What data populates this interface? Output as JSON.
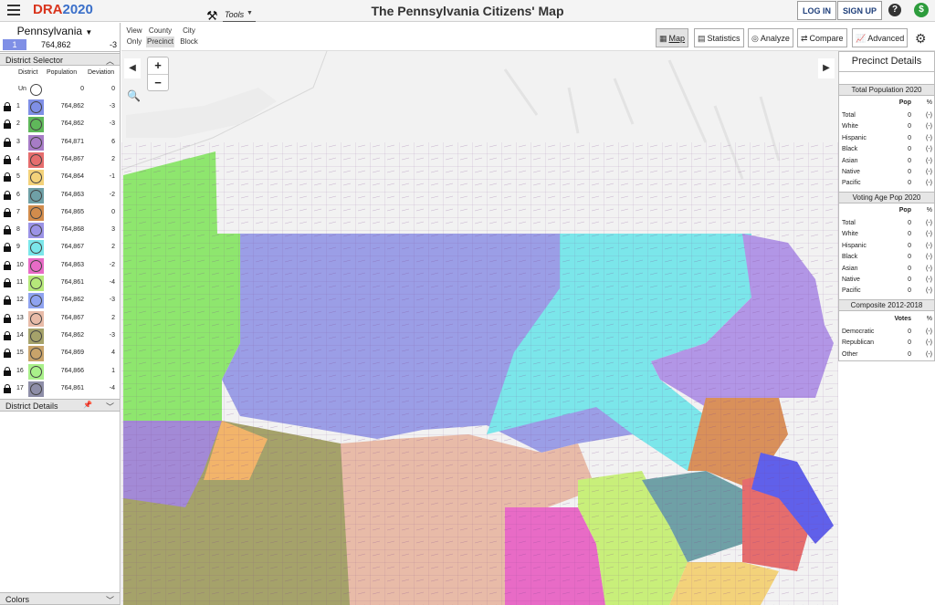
{
  "topbar": {
    "logo_dra": "DRA",
    "logo_year": "2020",
    "title": "The Pennsylvania Citizens' Map",
    "login_label": "LOG IN",
    "signup_label": "SIGN UP",
    "help_icon": "?",
    "dollar_icon": "$"
  },
  "state": {
    "name": "Pennsylvania",
    "swatch_label": "1",
    "population": "764,862",
    "deviation": "-3"
  },
  "district_selector": {
    "title": "District Selector",
    "col_district": "District",
    "col_population": "Population",
    "col_deviation": "Deviation",
    "unassigned": {
      "label": "Un",
      "population": "0",
      "deviation": "0"
    },
    "rows": [
      {
        "num": "1",
        "pop": "764,862",
        "dev": "-3",
        "color": "#7f8fe6"
      },
      {
        "num": "2",
        "pop": "764,862",
        "dev": "-3",
        "color": "#5fb85a"
      },
      {
        "num": "3",
        "pop": "764,871",
        "dev": "6",
        "color": "#a77cc6"
      },
      {
        "num": "4",
        "pop": "764,867",
        "dev": "2",
        "color": "#e56d6d"
      },
      {
        "num": "5",
        "pop": "764,864",
        "dev": "-1",
        "color": "#f3d27a"
      },
      {
        "num": "6",
        "pop": "764,863",
        "dev": "-2",
        "color": "#6fa0a6"
      },
      {
        "num": "7",
        "pop": "764,865",
        "dev": "0",
        "color": "#d28c4c"
      },
      {
        "num": "8",
        "pop": "764,868",
        "dev": "3",
        "color": "#9b93e6"
      },
      {
        "num": "9",
        "pop": "764,867",
        "dev": "2",
        "color": "#7be6ea"
      },
      {
        "num": "10",
        "pop": "764,863",
        "dev": "-2",
        "color": "#e86bc6"
      },
      {
        "num": "11",
        "pop": "764,861",
        "dev": "-4",
        "color": "#b6e87a"
      },
      {
        "num": "12",
        "pop": "764,862",
        "dev": "-3",
        "color": "#8fa3f0"
      },
      {
        "num": "13",
        "pop": "764,867",
        "dev": "2",
        "color": "#e8bba8"
      },
      {
        "num": "14",
        "pop": "764,862",
        "dev": "-3",
        "color": "#a5a26a"
      },
      {
        "num": "15",
        "pop": "764,869",
        "dev": "4",
        "color": "#c8a36a"
      },
      {
        "num": "16",
        "pop": "764,866",
        "dev": "1",
        "color": "#a9f08a"
      },
      {
        "num": "17",
        "pop": "764,861",
        "dev": "-4",
        "color": "#8e8ea8"
      }
    ],
    "details_title": "District Details",
    "colors_title": "Colors"
  },
  "toolbar": {
    "view_line1": "View",
    "view_line2": "Only",
    "county_label": "County",
    "precinct_label": "Precinct",
    "city_label": "City",
    "block_label": "Block",
    "tools_label": "Tools",
    "map_label": "Map",
    "statistics_label": "Statistics",
    "analyze_label": "Analyze",
    "compare_label": "Compare",
    "advanced_label": "Advanced"
  },
  "map": {
    "zoom_in": "+",
    "zoom_out": "−"
  },
  "precinct_details": {
    "title": "Precinct Details",
    "total_pop_title": "Total Population 2020",
    "vap_title": "Voting Age Pop 2020",
    "composite_title": "Composite 2012-2018",
    "col_pop": "Pop",
    "col_pct": "%",
    "col_votes": "Votes",
    "total_pop_rows": [
      {
        "label": "Total",
        "val": "0",
        "pct": "(-)"
      },
      {
        "label": "White",
        "val": "0",
        "pct": "(-)"
      },
      {
        "label": "Hispanic",
        "val": "0",
        "pct": "(-)"
      },
      {
        "label": "Black",
        "val": "0",
        "pct": "(-)"
      },
      {
        "label": "Asian",
        "val": "0",
        "pct": "(-)"
      },
      {
        "label": "Native",
        "val": "0",
        "pct": "(-)"
      },
      {
        "label": "Pacific",
        "val": "0",
        "pct": "(-)"
      }
    ],
    "vap_rows": [
      {
        "label": "Total",
        "val": "0",
        "pct": "(-)"
      },
      {
        "label": "White",
        "val": "0",
        "pct": "(-)"
      },
      {
        "label": "Hispanic",
        "val": "0",
        "pct": "(-)"
      },
      {
        "label": "Black",
        "val": "0",
        "pct": "(-)"
      },
      {
        "label": "Asian",
        "val": "0",
        "pct": "(-)"
      },
      {
        "label": "Native",
        "val": "0",
        "pct": "(-)"
      },
      {
        "label": "Pacific",
        "val": "0",
        "pct": "(-)"
      }
    ],
    "composite_rows": [
      {
        "label": "Democratic",
        "val": "0",
        "pct": "(-)"
      },
      {
        "label": "Republican",
        "val": "0",
        "pct": "(-)"
      },
      {
        "label": "Other",
        "val": "0",
        "pct": "(-)"
      }
    ]
  }
}
